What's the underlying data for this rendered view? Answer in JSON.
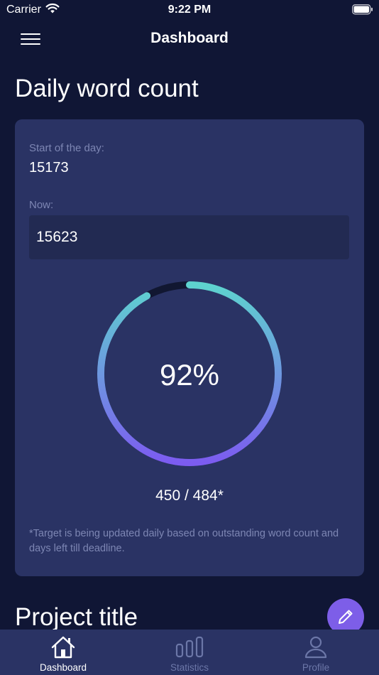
{
  "status_bar": {
    "carrier": "Carrier",
    "time": "9:22 PM"
  },
  "nav": {
    "title": "Dashboard",
    "menu_icon": "hamburger-menu-icon"
  },
  "daily": {
    "title": "Daily word count",
    "start_label": "Start of the day:",
    "start_value": "15173",
    "now_label": "Now:",
    "now_value": "15623",
    "progress_fraction": 0.92,
    "percent_text": "92%",
    "ratio_text": "450 / 484*",
    "footnote": "*Target is being updated daily based on outstanding word count and days left till deadline."
  },
  "project": {
    "title": "Project title"
  },
  "fab": {
    "icon": "pencil-icon"
  },
  "tabs": [
    {
      "label": "Dashboard",
      "icon": "home-icon",
      "active": true
    },
    {
      "label": "Statistics",
      "icon": "bar-chart-icon",
      "active": false
    },
    {
      "label": "Profile",
      "icon": "person-icon",
      "active": false
    }
  ],
  "colors": {
    "background": "#101635",
    "card": "#2a3364",
    "accent_purple": "#7d5ee8",
    "ring_start": "#7c5cf0",
    "ring_end": "#5ed3cf"
  }
}
